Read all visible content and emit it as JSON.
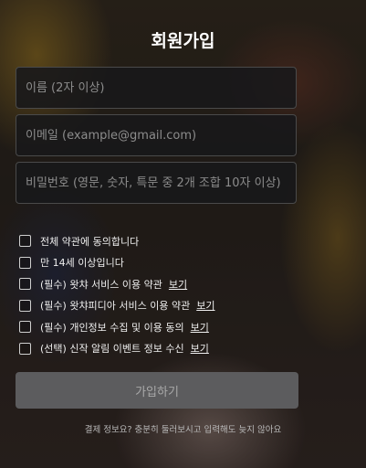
{
  "title": "회원가입",
  "fields": {
    "name_placeholder": "이름 (2자 이상)",
    "email_placeholder": "이메일 (example@gmail.com)",
    "password_placeholder": "비밀번호 (영문, 숫자, 특문 중 2개 조합 10자 이상)"
  },
  "agreements": [
    {
      "label": "전체 약관에 동의합니다",
      "link": ""
    },
    {
      "label": "만 14세 이상입니다",
      "link": ""
    },
    {
      "label": "(필수) 왓챠 서비스 이용 약관",
      "link": "보기"
    },
    {
      "label": "(필수) 왓챠피디아 서비스 이용 약관",
      "link": "보기"
    },
    {
      "label": "(필수) 개인정보 수집 및 이용 동의",
      "link": "보기"
    },
    {
      "label": "(선택) 신작 알림 이벤트 정보 수신",
      "link": "보기"
    }
  ],
  "submit_label": "가입하기",
  "footer_text": "결제 정보요? 충분히 둘러보시고 입력해도 늦지 않아요"
}
